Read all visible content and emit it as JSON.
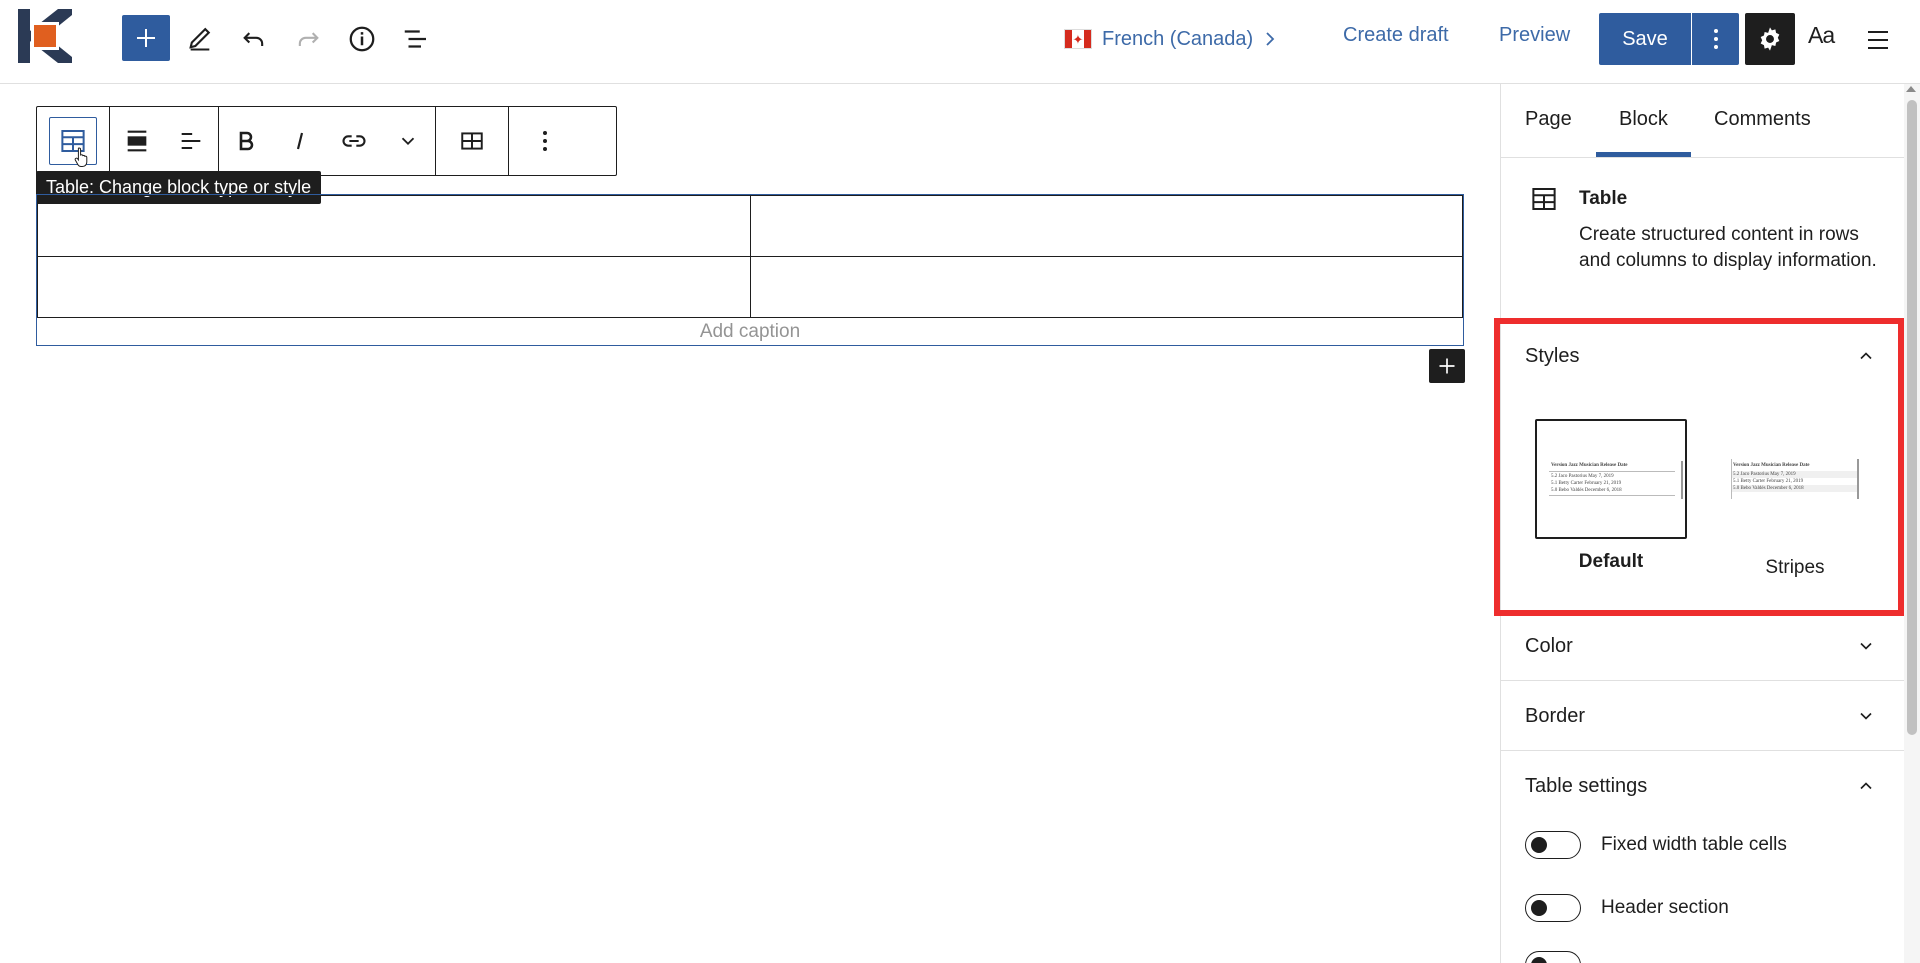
{
  "topbar": {
    "language": "French (Canada)",
    "create_draft": "Create draft",
    "preview": "Preview",
    "save": "Save",
    "typography_label": "Aa"
  },
  "block_toolbar": {
    "tooltip": "Table: Change block type or style"
  },
  "table_block": {
    "rows": [
      [
        "",
        ""
      ],
      [
        "",
        ""
      ]
    ],
    "caption_placeholder": "Add caption"
  },
  "sidebar": {
    "tabs": [
      "Page",
      "Block",
      "Comments"
    ],
    "active_tab": "Block",
    "block_card": {
      "title": "Table",
      "description": "Create structured content in rows and columns to display information."
    },
    "styles": {
      "title": "Styles",
      "options": [
        {
          "label": "Default",
          "selected": true
        },
        {
          "label": "Stripes",
          "selected": false
        }
      ]
    },
    "panels": {
      "color": "Color",
      "border": "Border",
      "table_settings": "Table settings"
    },
    "toggles": [
      {
        "label": "Fixed width table cells",
        "on": false
      },
      {
        "label": "Header section",
        "on": false
      }
    ]
  },
  "colors": {
    "accent": "#2f5c9e",
    "highlight": "#ee2d2d",
    "dark": "#1e1e1e"
  }
}
